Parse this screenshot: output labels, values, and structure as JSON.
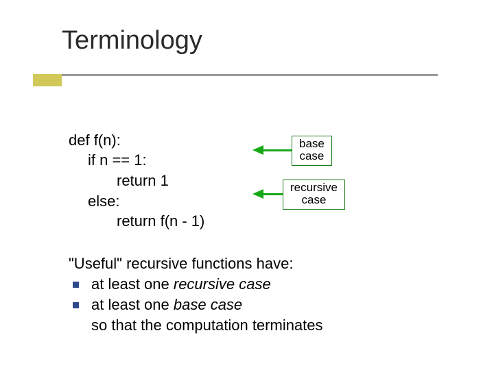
{
  "title": "Terminology",
  "code": {
    "l1": "def f(n):",
    "l2": "if n == 1:",
    "l3": "return 1",
    "l4": "else:",
    "l5": "return f(n - 1)"
  },
  "annotations": {
    "base1": "base",
    "base2": "case",
    "rec1": "recursive",
    "rec2": "case"
  },
  "para_lead": "\"Useful\" recursive functions have:",
  "bullets": {
    "b1_pre": "at least one ",
    "b1_em": "recursive case",
    "b2_pre": "at least one ",
    "b2_em": "base case"
  },
  "tail": "so that the computation terminates"
}
